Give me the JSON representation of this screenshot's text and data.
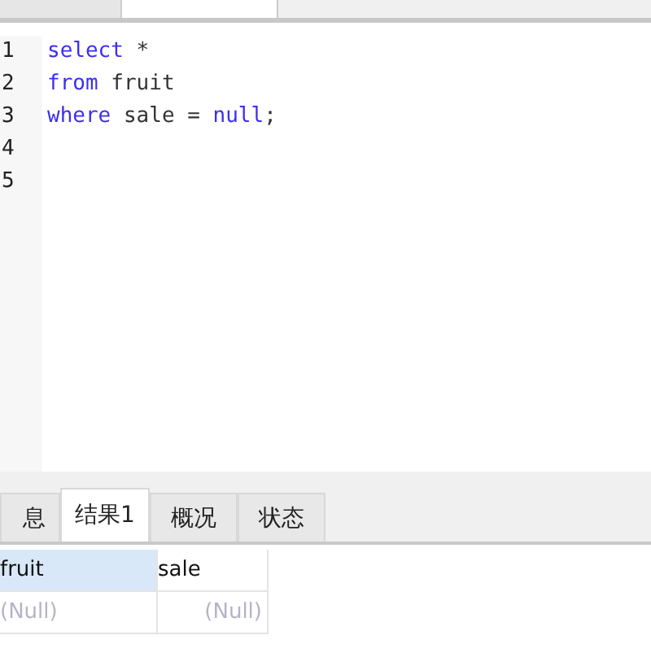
{
  "editor_tabs": [
    {
      "selected": false
    },
    {
      "selected": true
    }
  ],
  "editor": {
    "lines": [
      {
        "number": "1",
        "tokens": [
          {
            "text": "select",
            "kind": "keyword"
          },
          {
            "text": " *",
            "kind": "plain"
          }
        ]
      },
      {
        "number": "2",
        "tokens": [
          {
            "text": "from",
            "kind": "keyword"
          },
          {
            "text": " fruit",
            "kind": "plain"
          }
        ]
      },
      {
        "number": "3",
        "tokens": [
          {
            "text": "where",
            "kind": "keyword"
          },
          {
            "text": " sale = ",
            "kind": "plain"
          },
          {
            "text": "null",
            "kind": "keyword"
          },
          {
            "text": ";",
            "kind": "plain"
          }
        ]
      },
      {
        "number": "4"
      },
      {
        "number": "5"
      }
    ]
  },
  "result_tabs": [
    {
      "label": "息",
      "selected": false
    },
    {
      "label": "结果1",
      "selected": true
    },
    {
      "label": "概况",
      "selected": false
    },
    {
      "label": "状态",
      "selected": false
    }
  ],
  "table": {
    "columns": [
      {
        "label": "fruit",
        "selected": true
      },
      {
        "label": "sale",
        "selected": false
      }
    ],
    "rows": [
      [
        "(Null)",
        "(Null)"
      ]
    ]
  }
}
